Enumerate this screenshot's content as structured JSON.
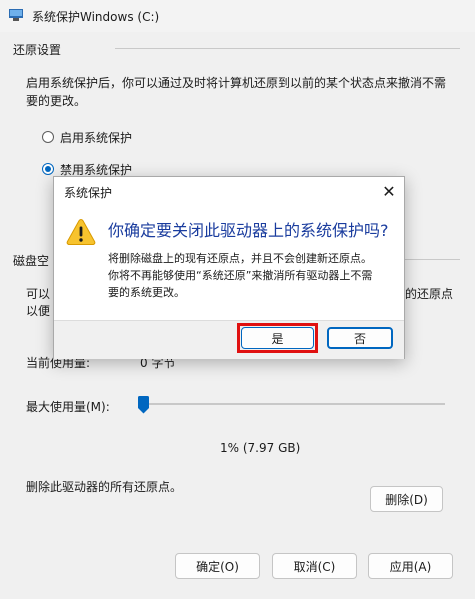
{
  "window": {
    "title": "系统保护Windows (C:)"
  },
  "restore_settings": {
    "heading": "还原设置",
    "description_line1": "启用系统保护后，你可以通过及时将计算机还原到以前的某个状态点来撤消不需",
    "description_line2": "要的更改。",
    "options": [
      {
        "label": "启用系统保护",
        "checked": false
      },
      {
        "label": "禁用系统保护",
        "checked": true
      }
    ]
  },
  "disk_usage": {
    "heading_partial": "磁盘空",
    "desc_left_1": "可以",
    "desc_left_2": "以便",
    "desc_right": "的还原点",
    "current_usage_label": "当前使用量:",
    "current_usage_value": "0 字节",
    "max_usage_label": "最大使用量(M):",
    "max_usage_fraction": 0.01,
    "max_usage_value": "1% (7.97 GB)"
  },
  "delete_section": {
    "text": "删除此驱动器的所有还原点。",
    "delete_button": "删除(D)"
  },
  "footer_buttons": {
    "ok": "确定(O)",
    "cancel": "取消(C)",
    "apply": "应用(A)"
  },
  "dialog": {
    "title": "系统保护",
    "close_glyph": "✕",
    "main_instruction": "你确定要关闭此驱动器上的系统保护吗?",
    "content_line1": "将删除磁盘上的现有还原点，并且不会创建新还原点。",
    "content_line2": "你将不再能够使用“系统还原”来撤消所有驱动器上不需",
    "content_line3": "要的系统更改。",
    "yes_button": "是",
    "no_button": "否",
    "icon": "warning-icon",
    "highlight_color": "#e01010"
  }
}
